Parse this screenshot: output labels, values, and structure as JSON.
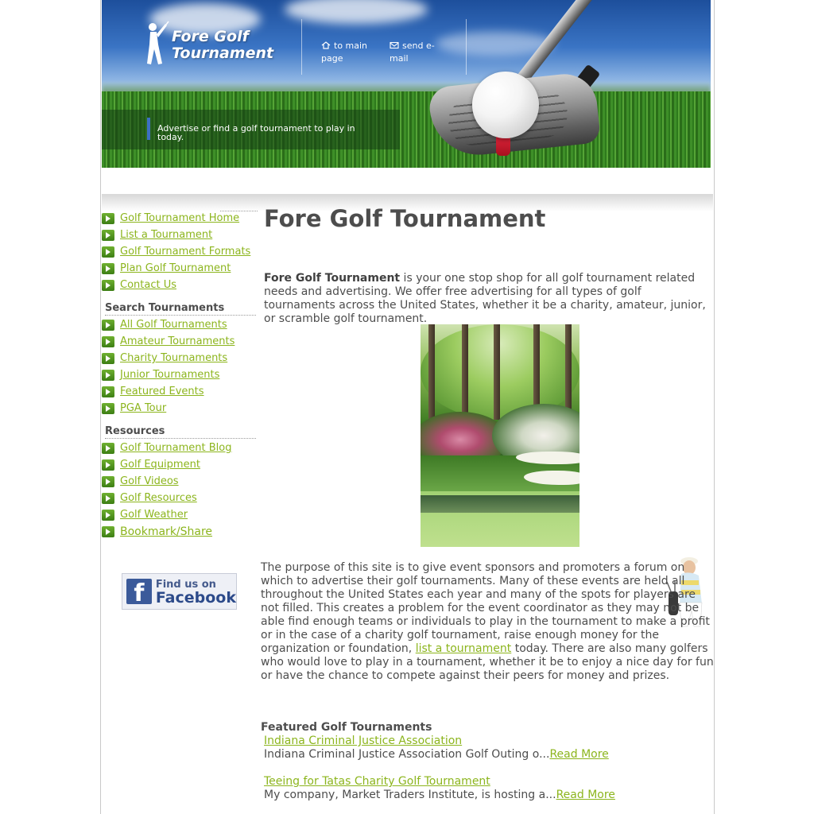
{
  "header": {
    "logo_line1": "Fore Golf",
    "logo_line2": "Tournament",
    "main_page_link": "to main page",
    "email_link": "send e-mail",
    "tagline": "Advertise or find a golf tournament to play in today."
  },
  "sidebar": {
    "nav_items": [
      {
        "label": "Golf Tournament Home"
      },
      {
        "label": "List a Tournament"
      },
      {
        "label": "Golf Tournament Formats"
      },
      {
        "label": "Plan Golf Tournament"
      },
      {
        "label": "Contact Us"
      }
    ],
    "search_heading": "Search Tournaments",
    "search_items": [
      {
        "label": "All Golf Tournaments"
      },
      {
        "label": "Amateur Tournaments"
      },
      {
        "label": "Charity Tournaments"
      },
      {
        "label": "Junior Tournaments"
      },
      {
        "label": "Featured Events"
      },
      {
        "label": "PGA Tour"
      }
    ],
    "resources_heading": "Resources",
    "resource_items": [
      {
        "label": "Golf Tournament Blog"
      },
      {
        "label": "Golf Equipment"
      },
      {
        "label": "Golf Videos"
      },
      {
        "label": "Golf Resources"
      },
      {
        "label": "Golf Weather"
      },
      {
        "label": "Bookmark/Share"
      }
    ],
    "facebook": {
      "line1": "Find us on",
      "line2": "Facebook"
    }
  },
  "main": {
    "title": "Fore Golf Tournament",
    "intro_bold": "Fore Golf Tournament",
    "intro_rest": " is your one stop shop for all golf tournament related needs and advertising. We offer free advertising for all types of golf tournaments across the United States, whether it be a charity, amateur, junior, or scramble golf tournament.",
    "body_part1": "The purpose of this site is to give event sponsors and promoters a forum on which to advertise their golf tournaments.  Many of these events are held all throughout the United States each year and many of the spots for players are not filled.  This creates a problem for the event coordinator as they may not be able find enough teams or individuals to play in the tournament to make a profit or in the case of a charity golf tournament, raise enough money for the organization or foundation, ",
    "body_link": "list a tournament",
    "body_part2": " today.  There are also many golfers who would love to play in a tournament, whether it be to enjoy a nice day for fun or have the chance to compete against their peers for money and prizes.",
    "featured_heading": "Featured Golf Tournaments",
    "featured": [
      {
        "title": "Indiana Criminal Justice Association",
        "desc": "Indiana Criminal Justice Association Golf Outing o...",
        "read_more": "Read More"
      },
      {
        "title": "Teeing for Tatas Charity Golf Tournament ",
        "desc": "My company, Market Traders Institute, is hosting a...",
        "read_more": "Read More"
      }
    ]
  },
  "colors": {
    "link": "#8cb51d",
    "text": "#4d4d4d",
    "nav_arrow": "#4f9420",
    "facebook": "#3b5a9a"
  }
}
